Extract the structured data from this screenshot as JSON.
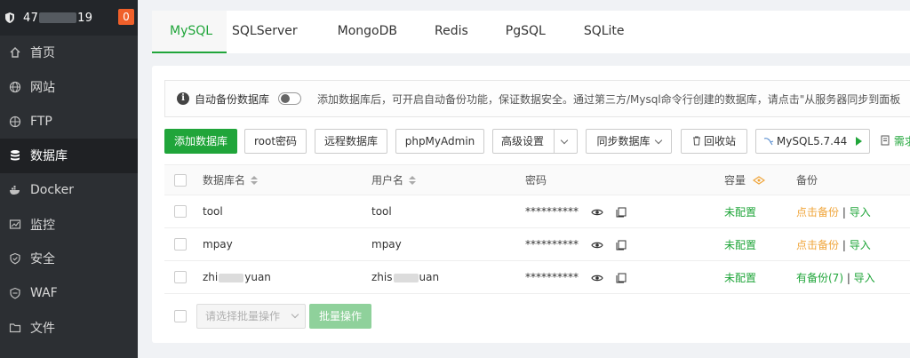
{
  "sidebar": {
    "server_prefix": "47",
    "server_suffix": "19",
    "badge": "0",
    "items": [
      {
        "label": "首页",
        "icon": "home-icon"
      },
      {
        "label": "网站",
        "icon": "globe-icon"
      },
      {
        "label": "FTP",
        "icon": "ftp-icon"
      },
      {
        "label": "数据库",
        "icon": "database-icon"
      },
      {
        "label": "Docker",
        "icon": "docker-icon"
      },
      {
        "label": "监控",
        "icon": "monitor-icon"
      },
      {
        "label": "安全",
        "icon": "shield-icon"
      },
      {
        "label": "WAF",
        "icon": "waf-shield-icon"
      },
      {
        "label": "文件",
        "icon": "folder-icon"
      }
    ]
  },
  "tabs": [
    "MySQL",
    "SQLServer",
    "MongoDB",
    "Redis",
    "PgSQL",
    "SQLite"
  ],
  "notice": {
    "toggle_label": "自动备份数据库",
    "text": "添加数据库后，可开启自动备份功能，保证数据安全。通过第三方/Mysql命令行创建的数据库，请点击\"从服务器同步到面板"
  },
  "toolbar": {
    "add_db": "添加数据库",
    "root_pwd": "root密码",
    "remote_db": "远程数据库",
    "phpmyadmin": "phpMyAdmin",
    "advanced": "高级设置",
    "sync_db": "同步数据库",
    "recycle": "回收站",
    "mysql_version": "MySQL5.7.44",
    "more": "需求"
  },
  "table": {
    "headers": {
      "name": "数据库名",
      "user": "用户名",
      "password": "密码",
      "capacity": "容量",
      "backup": "备份"
    },
    "rows": [
      {
        "name": "tool",
        "user": "tool",
        "password": "**********",
        "capacity": "未配置",
        "backup": "点击备份",
        "import": "导入"
      },
      {
        "name": "mpay",
        "user": "mpay",
        "password": "**********",
        "capacity": "未配置",
        "backup": "点击备份",
        "import": "导入"
      },
      {
        "name_prefix": "zhi",
        "name_suffix": "yuan",
        "user_prefix": "zhis",
        "user_suffix": "uan",
        "password": "**********",
        "capacity": "未配置",
        "backup": "有备份(7)",
        "import": "导入"
      }
    ]
  },
  "footer": {
    "batch_placeholder": "请选择批量操作",
    "batch_button": "批量操作"
  },
  "colors": {
    "accent": "#20a53a",
    "orange": "#f0a53a",
    "sidebar_bg": "#2c2f33",
    "badge": "#f0602a"
  }
}
